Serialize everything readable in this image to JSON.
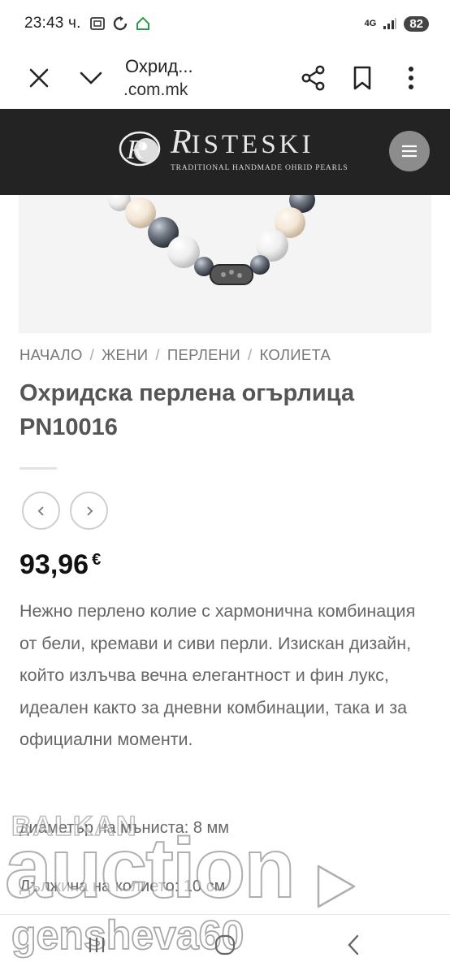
{
  "status_bar": {
    "time": "23:43 ч.",
    "network": "4G",
    "battery": "82",
    "icons": [
      "screenshot-icon",
      "sync-icon",
      "home-outline-icon",
      "signal-icon"
    ]
  },
  "browser": {
    "title": "Охрид...",
    "url": ".com.mk",
    "icons": [
      "close-icon",
      "chevron-down-icon",
      "share-icon",
      "bookmark-icon",
      "more-vert-icon"
    ]
  },
  "site": {
    "logo_name_initial": "R",
    "logo_name_rest": "ISTESKI",
    "logo_tagline": "TRADITIONAL HANDMADE OHRID PEARLS",
    "menu_icon": "hamburger-icon"
  },
  "breadcrumb": {
    "items": [
      "НАЧАЛО",
      "ЖЕНИ",
      "ПЕРЛЕНИ",
      "КОЛИЕТА"
    ],
    "separator": "/"
  },
  "product": {
    "title_line1": "Охридска перлена огърлица",
    "title_line2": "PN10016",
    "price": "93,96",
    "currency": "€",
    "description": "Нежно перлено колие с хармонична комбинация от бели, кремави и сиви перли. Изискан дизайн, който излъчва вечна елегантност и фин лукс, идеален както за дневни комбинации, така и за официални моменти.",
    "spec_diameter": "диаметър на мъниста: 8 мм",
    "spec_length": "Дължина на колието: 10 см"
  },
  "watermark": {
    "site_small": "BALKAN",
    "site_big": "auction",
    "user": "genshevа60"
  },
  "colors": {
    "header_bg": "#232323",
    "menu_button": "#8c8c8c",
    "title": "#555555",
    "price": "#111111"
  }
}
